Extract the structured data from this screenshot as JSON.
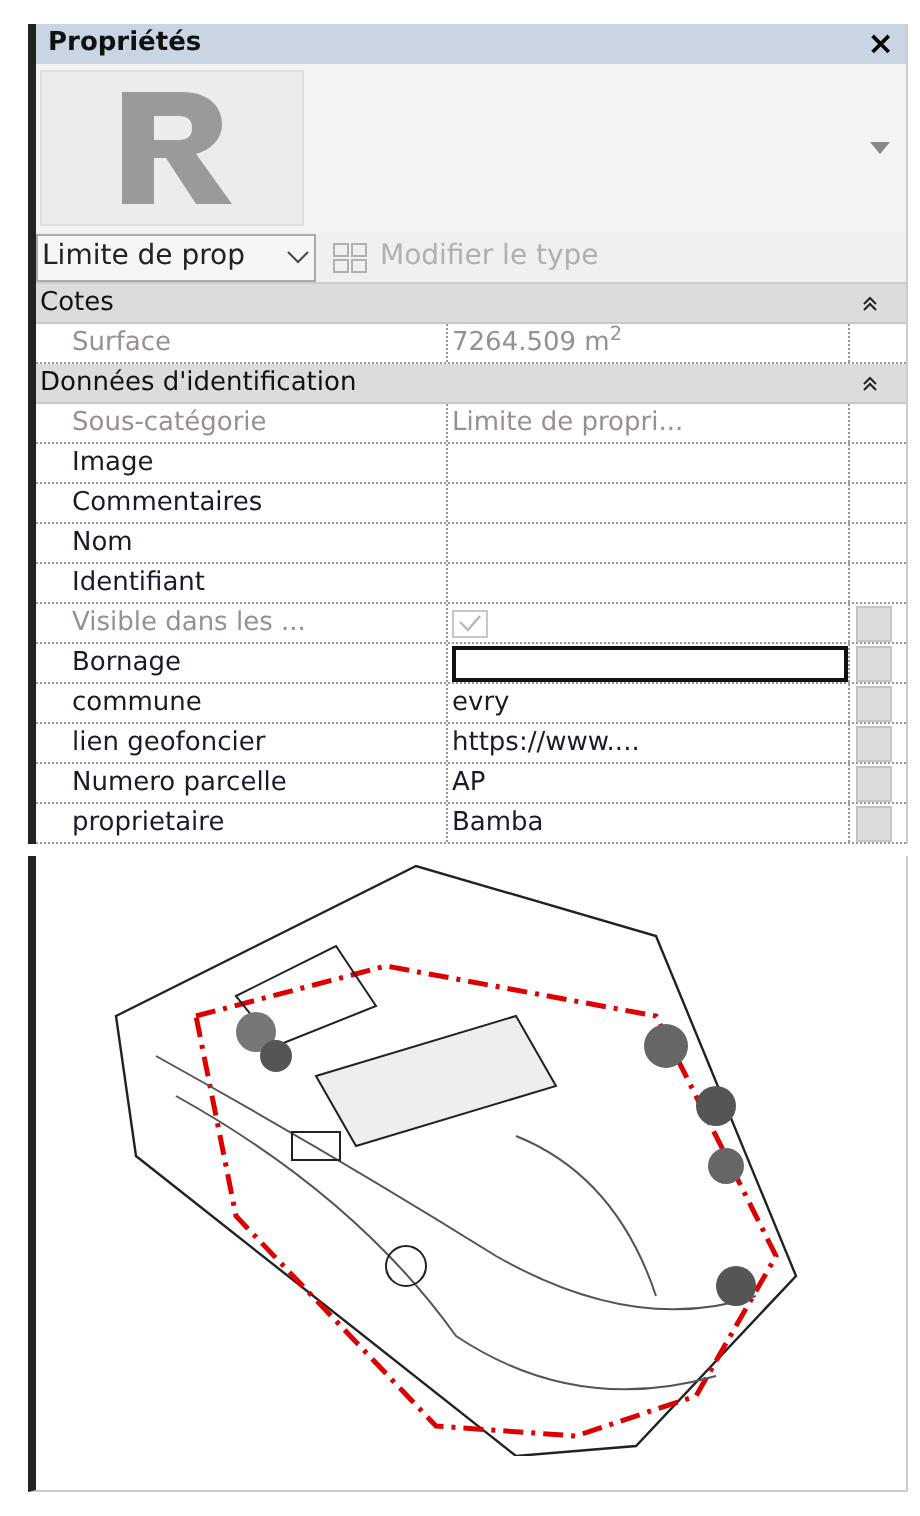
{
  "panel": {
    "title": "Propriétés",
    "close": "×"
  },
  "type_selector": {
    "value": "Limite de prop",
    "edit_type": "Modifier le type",
    "edit_type_disabled": true
  },
  "groups": [
    {
      "title": "Cotes",
      "expanded": true,
      "rows": [
        {
          "label": "Surface",
          "value": "7264.509 m$^{2}$",
          "kind": "text",
          "disabled": true,
          "button": false
        }
      ]
    },
    {
      "title": "Données d'identification",
      "expanded": true,
      "rows": [
        {
          "label": "Sous-catégorie",
          "value": "Limite de propri...",
          "kind": "text",
          "disabled": true,
          "button": false
        },
        {
          "label": "Image",
          "kind": "text",
          "disabled": false,
          "button": false
        },
        {
          "label": "Commentaires",
          "kind": "text",
          "disabled": false,
          "button": false
        },
        {
          "label": "Nom",
          "kind": "text",
          "disabled": false,
          "button": false
        },
        {
          "label": "Identifiant",
          "kind": "text",
          "disabled": false,
          "button": false
        },
        {
          "label": "Visible dans les ...",
          "kind": "checkbox",
          "checked": true,
          "disabled": true,
          "button": true
        },
        {
          "label": "Bornage",
          "kind": "editing",
          "disabled": false,
          "button": true
        },
        {
          "label": "commune",
          "value": "evry",
          "kind": "text",
          "disabled": false,
          "button": true
        },
        {
          "label": "lien geofoncier",
          "value": "https://www....",
          "kind": "text",
          "disabled": false,
          "button": true
        },
        {
          "label": "Numero parcelle",
          "value": "AP",
          "kind": "text",
          "disabled": false,
          "button": true
        },
        {
          "label": "proprietaire",
          "value": "Bamba",
          "kind": "text",
          "disabled": false,
          "button": true
        }
      ]
    }
  ]
}
